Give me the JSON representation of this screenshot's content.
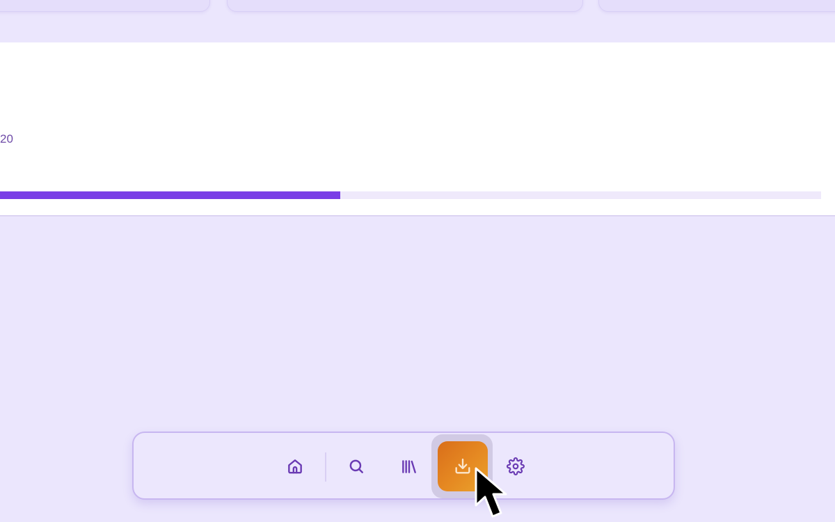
{
  "panel": {
    "text": "20",
    "progress_fraction": 0.424
  },
  "dock": {
    "items": [
      {
        "name": "home",
        "icon": "home-icon"
      },
      {
        "name": "search",
        "icon": "search-icon"
      },
      {
        "name": "library",
        "icon": "library-icon"
      },
      {
        "name": "downloads",
        "icon": "download-icon",
        "active": true
      },
      {
        "name": "settings",
        "icon": "gear-icon"
      }
    ]
  },
  "colors": {
    "background": "#ebe6fd",
    "accent": "#7a3ee6",
    "active_button": "#e68a22",
    "icon": "#6a3bb3"
  }
}
